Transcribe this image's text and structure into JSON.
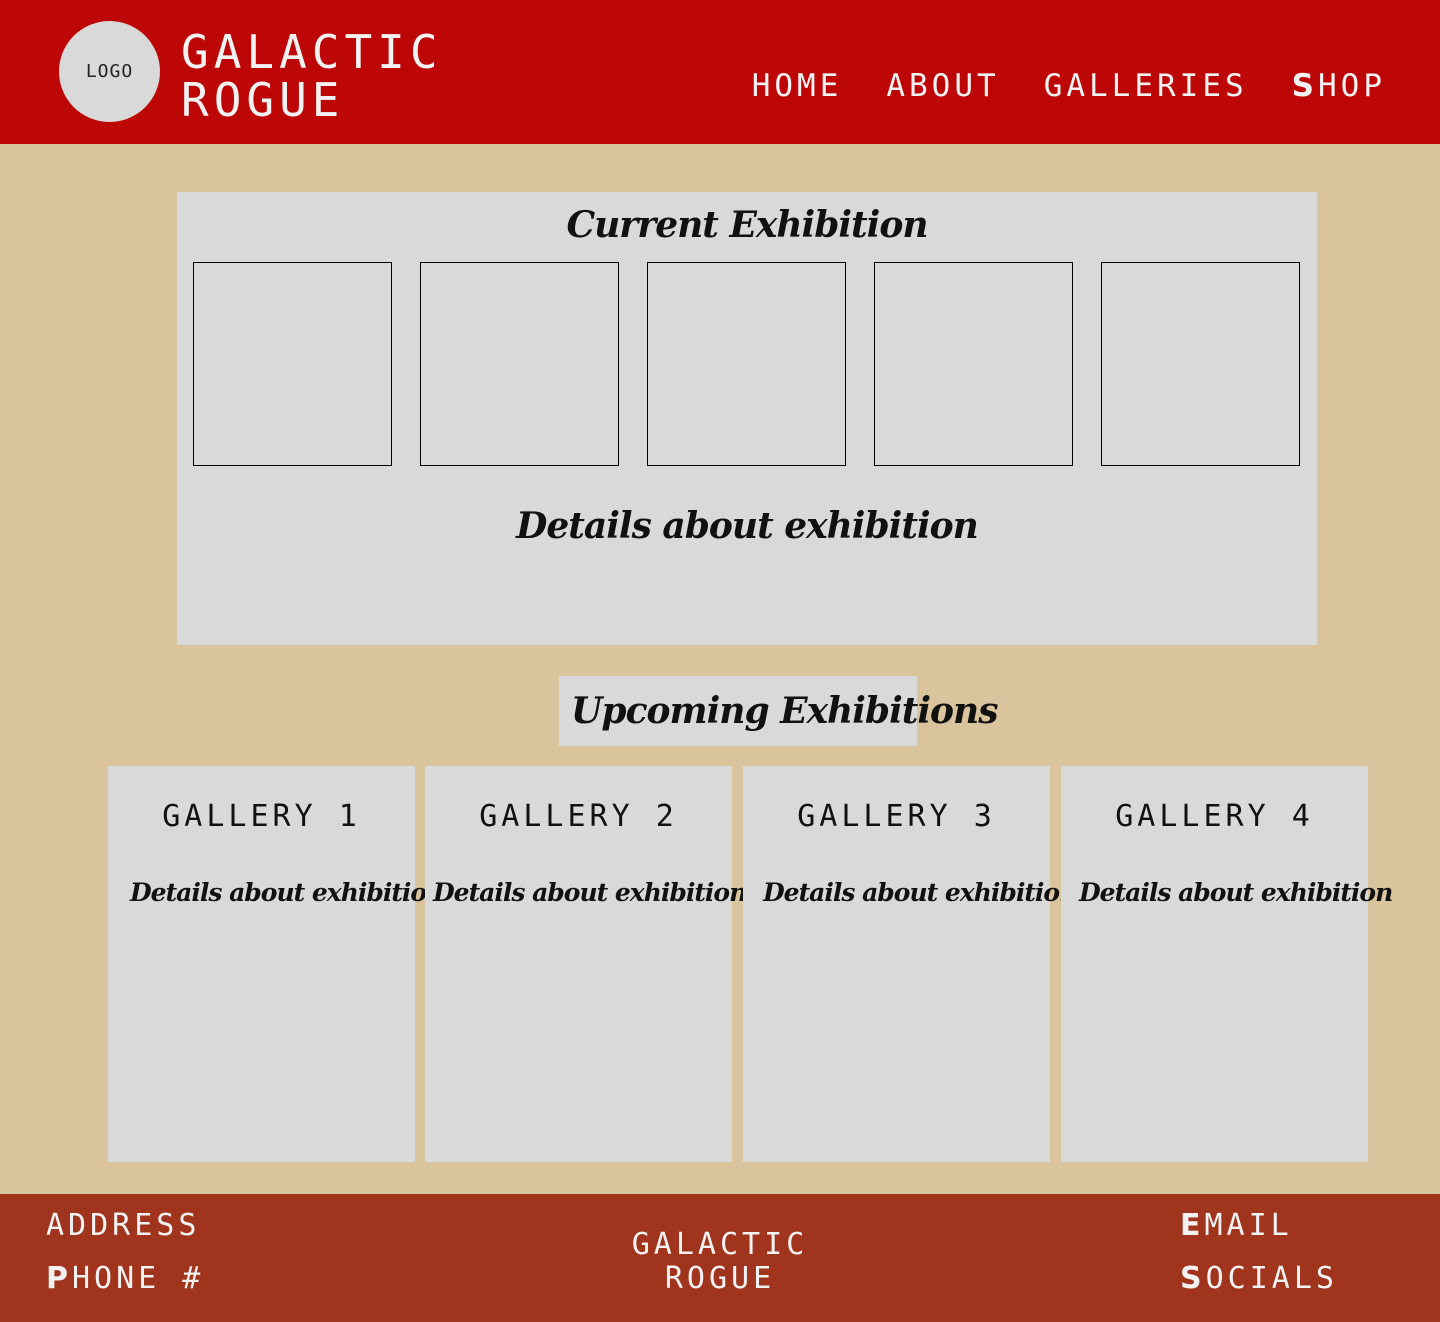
{
  "header": {
    "logo_label": "LOGO",
    "brand_line1": "GALACTIC",
    "brand_line2": "ROGUE",
    "nav": [
      {
        "label": "HOME"
      },
      {
        "label": "ABOUT"
      },
      {
        "label": "GALLERIES"
      },
      {
        "first": "S",
        "rest": "HOP"
      }
    ]
  },
  "current": {
    "title": "Current Exhibition",
    "details": "Details about exhibition"
  },
  "upcoming": {
    "title": "Upcoming Exhibitions",
    "galleries": [
      {
        "name": "GALLERY 1",
        "details": "Details about exhibition"
      },
      {
        "name": "GALLERY 2",
        "details": "Details about exhibition"
      },
      {
        "name": "GALLERY 3",
        "details": "Details about exhibition"
      },
      {
        "name": "GALLERY 4",
        "details": "Details about exhibition"
      }
    ]
  },
  "footer": {
    "address": "ADDRESS",
    "phone_first": "P",
    "phone_rest": "HONE #",
    "brand_line1": "GALACTIC",
    "brand_line2": "ROGUE",
    "email_first": "E",
    "email_rest": "MAIL",
    "socials_first": "S",
    "socials_rest": "OCIALS"
  },
  "colors": {
    "header_bg": "#bd0606",
    "page_bg": "#d9c49d",
    "card_bg": "#d9d9d9",
    "footer_bg": "#a0341c"
  }
}
